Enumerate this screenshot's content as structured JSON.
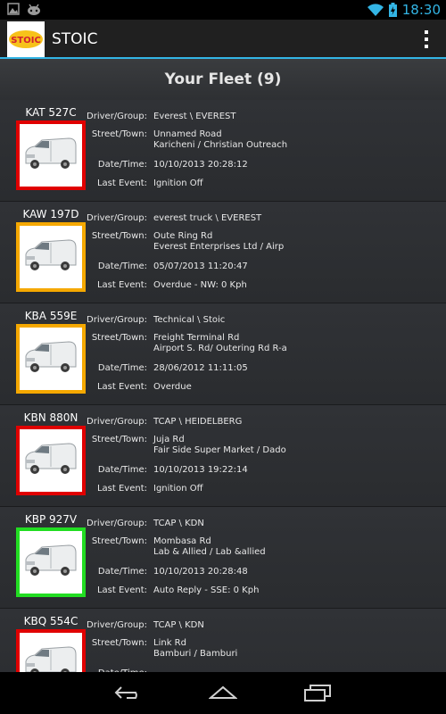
{
  "status_bar": {
    "time": "18:30",
    "icons": [
      "gallery-icon",
      "android-icon",
      "wifi-icon",
      "battery-charging-icon"
    ]
  },
  "app": {
    "title": "STOIC",
    "logo_text": "STOIC",
    "overflow_icon": "overflow-menu-icon"
  },
  "fleet": {
    "header": "Your Fleet (9)",
    "labels": {
      "driver": "Driver/Group:",
      "street": "Street/Town:",
      "datetime": "Date/Time:",
      "last_event": "Last Event:"
    },
    "vehicles": [
      {
        "plate": "KAT 527C",
        "status_color": "#e00000",
        "driver": "Everest \\ EVEREST",
        "street": "Unnamed Road",
        "town": "Karicheni / Christian Outreach",
        "datetime": "10/10/2013 20:28:12",
        "last_event": "Ignition Off"
      },
      {
        "plate": "KAW 197D",
        "status_color": "#f5a800",
        "driver": "everest truck \\ EVEREST",
        "street": "Oute Ring Rd",
        "town": "Everest Enterprises Ltd / Airp",
        "datetime": "05/07/2013 11:20:47",
        "last_event": "Overdue - NW: 0 Kph"
      },
      {
        "plate": "KBA 559E",
        "status_color": "#f5a800",
        "driver": "Technical \\ Stoic",
        "street": "Freight Terminal Rd",
        "town": "Airport S. Rd/ Outering Rd R-a",
        "datetime": "28/06/2012 11:11:05",
        "last_event": "Overdue"
      },
      {
        "plate": "KBN 880N",
        "status_color": "#e00000",
        "driver": "TCAP \\ HEIDELBERG",
        "street": "Juja Rd",
        "town": "Fair Side Super Market / Dado",
        "datetime": "10/10/2013 19:22:14",
        "last_event": "Ignition Off"
      },
      {
        "plate": "KBP 927V",
        "status_color": "#22dd22",
        "driver": "TCAP \\ KDN",
        "street": "Mombasa Rd",
        "town": "Lab & Allied / Lab &allied",
        "datetime": "10/10/2013 20:28:48",
        "last_event": "Auto Reply - SSE: 0 Kph"
      },
      {
        "plate": "KBQ 554C",
        "status_color": "#e00000",
        "driver": "TCAP \\ KDN",
        "street": "Link Rd",
        "town": "Bamburi / Bamburi",
        "datetime": "",
        "last_event": ""
      }
    ]
  },
  "nav_bar": {
    "icons": [
      "back-icon",
      "home-icon",
      "recent-apps-icon"
    ]
  }
}
